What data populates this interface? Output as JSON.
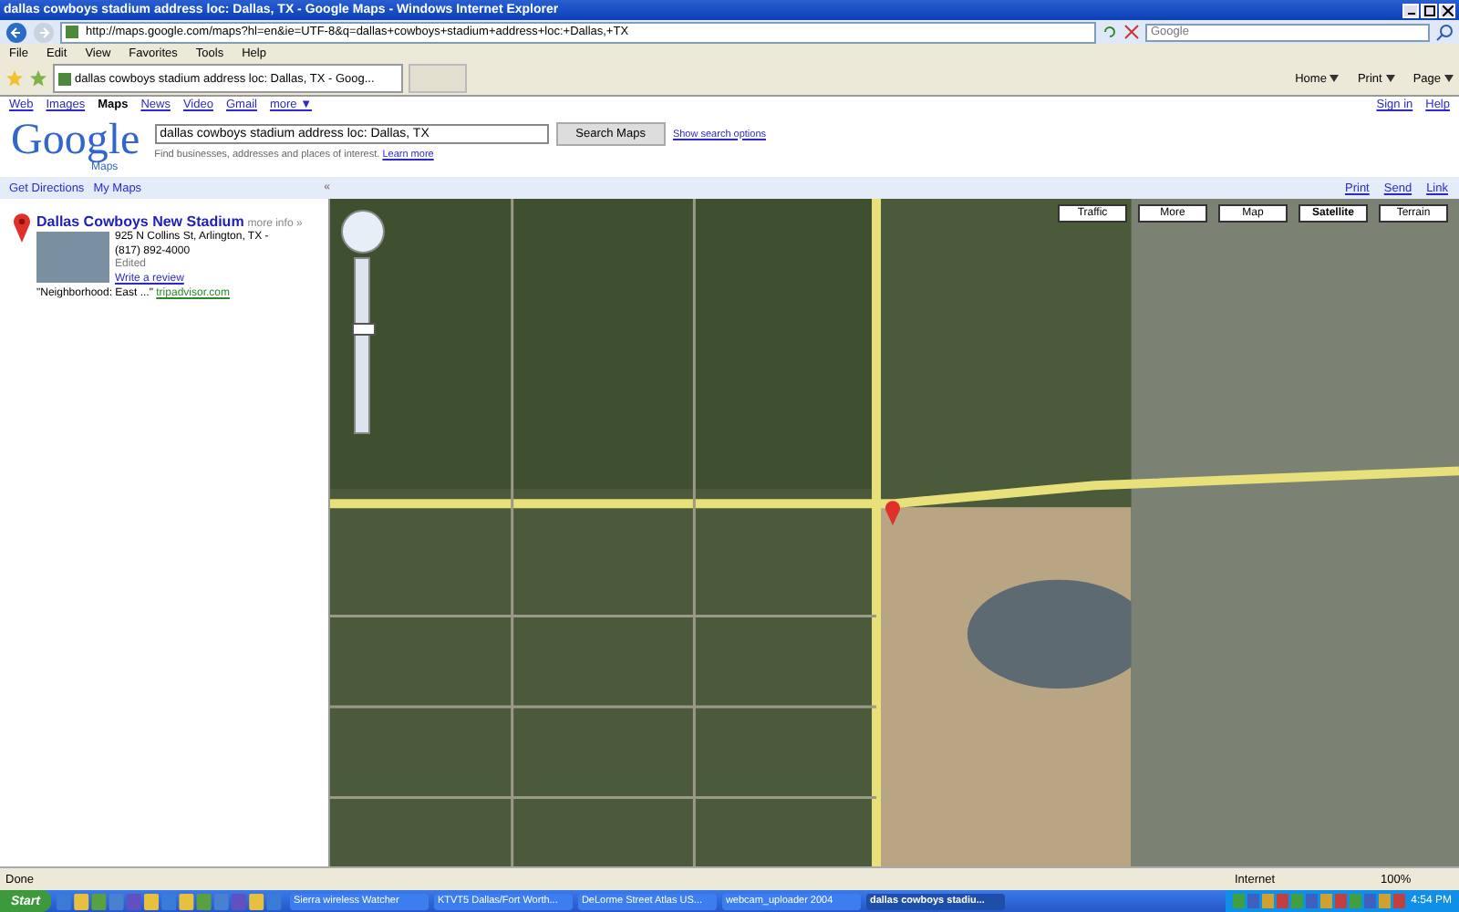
{
  "window": {
    "title": "dallas cowboys stadium address loc: Dallas, TX - Google Maps - Windows Internet Explorer"
  },
  "address_bar": {
    "value": "http://maps.google.com/maps?hl=en&ie=UTF-8&q=dallas+cowboys+stadium+address+loc:+Dallas,+TX"
  },
  "search_box": {
    "placeholder": "Google"
  },
  "menu": [
    "File",
    "Edit",
    "View",
    "Favorites",
    "Tools",
    "Help"
  ],
  "tab": {
    "label": "dallas cowboys stadium address loc: Dallas, TX - Goog..."
  },
  "command_bar": [
    "Home",
    "Print",
    "Page"
  ],
  "google_nav": [
    {
      "label": "Web",
      "selected": false
    },
    {
      "label": "Images",
      "selected": false
    },
    {
      "label": "Maps",
      "selected": true
    },
    {
      "label": "News",
      "selected": false
    },
    {
      "label": "Video",
      "selected": false
    },
    {
      "label": "Gmail",
      "selected": false
    },
    {
      "label": "more ▼",
      "selected": false
    }
  ],
  "account_links": [
    "Sign in",
    "Help"
  ],
  "logo": {
    "text": "Google",
    "sub": "Maps"
  },
  "search": {
    "value": "dallas cowboys stadium address loc: Dallas, TX",
    "button": "Search Maps",
    "options_link": "Show search options",
    "hint": "Find businesses, addresses and places of interest.",
    "hint_link": "Learn more"
  },
  "panel_tabs": [
    "Get Directions",
    "My Maps"
  ],
  "panel_close": "«",
  "map_links": [
    "Print",
    "Send",
    "Link"
  ],
  "result": {
    "title": "Dallas Cowboys New Stadium",
    "more": "more info »",
    "address": "925 N Collins St, Arlington, TX -",
    "phone": "(817) 892-4000",
    "edited": "Edited",
    "review": "Write a review",
    "snippet": "\"Neighborhood: East ...\"",
    "source": "tripadvisor.com"
  },
  "zoom_slider": {
    "level": 0.6
  },
  "map_types": [
    {
      "label": "Traffic",
      "selected": false
    },
    {
      "label": "More",
      "selected": false
    },
    {
      "label": "Map",
      "selected": false
    },
    {
      "label": "Satellite",
      "selected": true
    },
    {
      "label": "Terrain",
      "selected": false
    }
  ],
  "status_bar": {
    "text": "Done",
    "zone": "Internet",
    "zoom": "100%"
  },
  "taskbar": {
    "start": "Start",
    "tasks": [
      {
        "label": "Sierra wireless Watcher",
        "selected": false
      },
      {
        "label": "KTVT5 Dallas/Fort Worth...",
        "selected": false
      },
      {
        "label": "DeLorme Street Atlas US...",
        "selected": false
      },
      {
        "label": "webcam_uploader 2004",
        "selected": false
      },
      {
        "label": "dallas cowboys stadiu...",
        "selected": true
      }
    ],
    "clock": "4:54 PM"
  }
}
